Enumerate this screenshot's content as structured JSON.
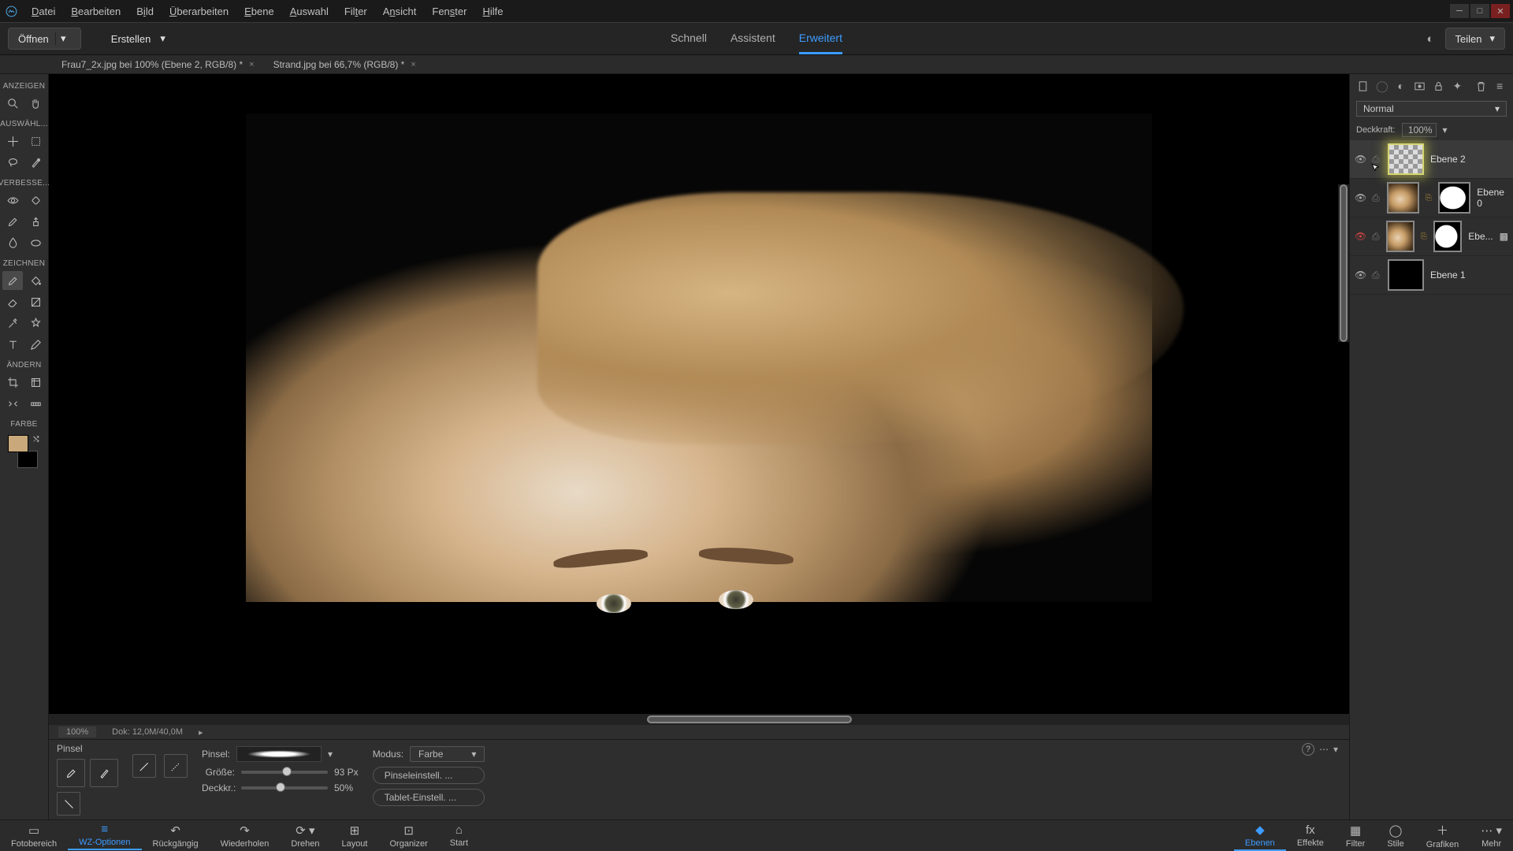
{
  "menu": [
    "Datei",
    "Bearbeiten",
    "Bild",
    "Überarbeiten",
    "Ebene",
    "Auswahl",
    "Filter",
    "Ansicht",
    "Fenster",
    "Hilfe"
  ],
  "menu_underline_idx": [
    0,
    0,
    1,
    0,
    0,
    0,
    3,
    1,
    3,
    0
  ],
  "open_btn": "Öffnen",
  "create_btn": "Erstellen",
  "modes": [
    "Schnell",
    "Assistent",
    "Erweitert"
  ],
  "active_mode": 2,
  "share_btn": "Teilen",
  "doc_tabs": [
    "Frau7_2x.jpg bei 100% (Ebene 2, RGB/8) *",
    "Strand.jpg bei 66,7% (RGB/8) *"
  ],
  "toolbox_headers": [
    "ANZEIGEN",
    "AUSWÄHL...",
    "VERBESSE...",
    "ZEICHNEN",
    "ÄNDERN",
    "FARBE"
  ],
  "status": {
    "zoom": "100%",
    "doc": "Dok: 12,0M/40,0M"
  },
  "tool_options": {
    "tool_title": "Pinsel",
    "brush_label": "Pinsel:",
    "mode_label": "Modus:",
    "mode_value": "Farbe",
    "size_label": "Größe:",
    "size_value": "93 Px",
    "opacity_label": "Deckkr.:",
    "opacity_value": "50%",
    "brush_settings": "Pinseleinstell. ...",
    "tablet_settings": "Tablet-Einstell. ..."
  },
  "right_panel": {
    "blend_mode": "Normal",
    "opacity_label": "Deckkraft:",
    "opacity_value": "100%",
    "layers": [
      {
        "name": "Ebene 2",
        "thumb": "checker",
        "selected": true
      },
      {
        "name": "Ebene 0",
        "thumb": "photo",
        "mask": true
      },
      {
        "name": "Ebe...",
        "thumb": "photo",
        "mask": true,
        "fx": true,
        "eye_red": true
      },
      {
        "name": "Ebene 1",
        "thumb": "black"
      }
    ]
  },
  "bottombar_left": [
    "Fotobereich",
    "WZ-Optionen",
    "Rückgängig",
    "Wiederholen",
    "Drehen",
    "Layout",
    "Organizer",
    "Start"
  ],
  "bottombar_right": [
    "Ebenen",
    "Effekte",
    "Filter",
    "Stile",
    "Grafiken",
    "Mehr"
  ],
  "bottombar_left_active": 1,
  "bottombar_right_active": 0,
  "colors": {
    "accent": "#3d9cff",
    "foreground": "#c9a97b",
    "background_swatch": "#000000"
  }
}
